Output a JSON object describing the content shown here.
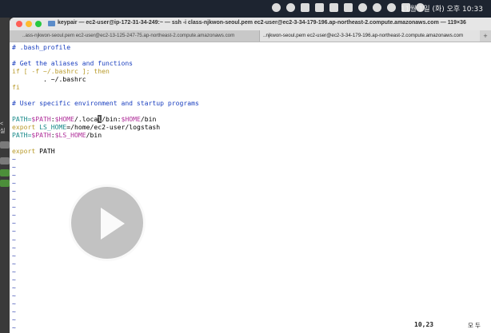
{
  "menubar": {
    "clock": "11월 1일 (화) 오후 10:33",
    "status_icons": [
      "screen-record-icon",
      "record-icon",
      "display-icon",
      "monitor-icon",
      "cast-icon",
      "keyboard-input-icon",
      "volume-icon",
      "wifi-icon",
      "search-icon",
      "control-center-icon",
      "siri-icon"
    ]
  },
  "left_app": {
    "peek_text": "< 실"
  },
  "terminal": {
    "title": "keypair — ec2-user@ip-172-31-34-249:~ — ssh -i class-njkwon-seoul.pem ec2-user@ec2-3-34-179-196.ap-northeast-2.compute.amazonaws.com — 119×36",
    "tabs": [
      {
        "label": "..ass-njkwon-seoul.pem ec2-user@ec2-13-125-247-75.ap-northeast-2.compute.amazonaws.com"
      },
      {
        "label": "..njkwon-seoul.pem ec2-user@ec2-3-34-179-196.ap-northeast-2.compute.amazonaws.com"
      }
    ],
    "add_tab": "+",
    "lines": {
      "l1": "# .bash_profile",
      "l3": "# Get the aliases and functions",
      "l4_if": "if",
      "l4_test": " [ -f ~/.bashrc ]; ",
      "l4_then": "then",
      "l5": "        . ~/.bashrc",
      "l6": "fi",
      "l8": "# User specific environment and startup programs",
      "l10_a": "PATH=",
      "l10_b": "$PATH",
      "l10_c": ":",
      "l10_d": "$HOME",
      "l10_e": "/.loca",
      "l10_cursor": "l",
      "l10_f": "/bin:",
      "l10_g": "$HOME",
      "l10_h": "/bin",
      "l11_a": "export",
      "l11_b": " LS_HOME",
      "l11_c": "=/home/ec2-user/logstash",
      "l12_a": "PATH=",
      "l12_b": "$PATH",
      "l12_c": ":",
      "l12_d": "$LS_HOME",
      "l12_e": "/bin",
      "l14_a": "export",
      "l14_b": " PATH",
      "tilde": "~"
    },
    "ruler": "10,23",
    "mode": "모 두"
  },
  "overlay": {
    "icon": "play-icon"
  }
}
